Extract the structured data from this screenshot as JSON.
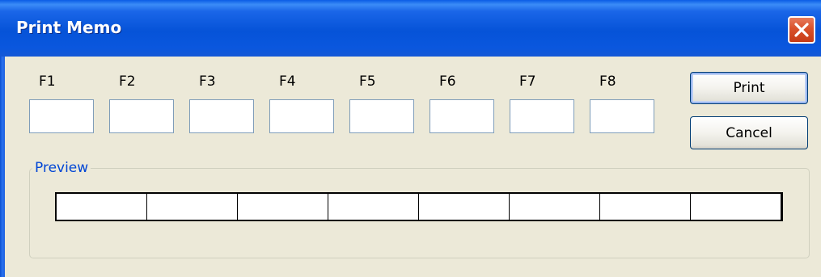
{
  "window": {
    "title": "Print Memo",
    "close_icon": "close-icon"
  },
  "fields": [
    {
      "label": "F1",
      "value": ""
    },
    {
      "label": "F2",
      "value": ""
    },
    {
      "label": "F3",
      "value": ""
    },
    {
      "label": "F4",
      "value": ""
    },
    {
      "label": "F5",
      "value": ""
    },
    {
      "label": "F6",
      "value": ""
    },
    {
      "label": "F7",
      "value": ""
    },
    {
      "label": "F8",
      "value": ""
    }
  ],
  "buttons": {
    "print_label": "Print",
    "cancel_label": "Cancel"
  },
  "preview": {
    "label": "Preview",
    "cells": [
      "",
      "",
      "",
      "",
      "",
      "",
      "",
      ""
    ]
  },
  "colors": {
    "titlebar": "#0653d8",
    "close_button": "#d9512a",
    "group_label": "#0046d5",
    "dialog_background": "#ece9d8"
  }
}
